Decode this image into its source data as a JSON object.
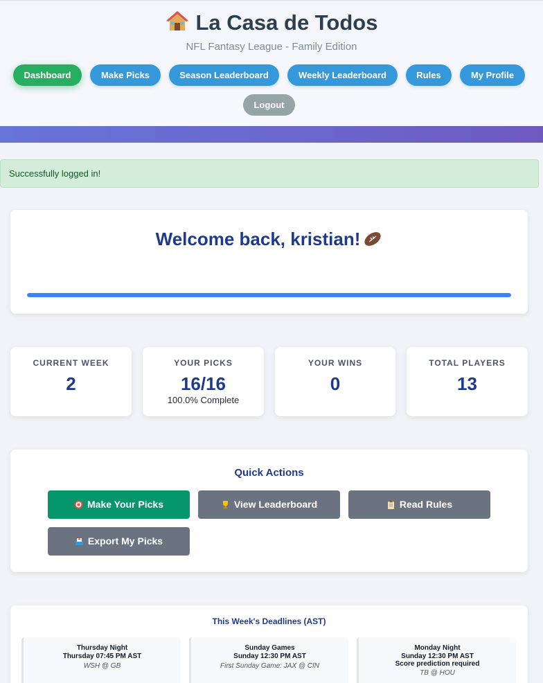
{
  "header": {
    "title": "La Casa de Todos",
    "subtitle": "NFL Fantasy League - Family Edition",
    "nav": [
      "Dashboard",
      "Make Picks",
      "Season Leaderboard",
      "Weekly Leaderboard",
      "Rules",
      "My Profile"
    ],
    "logout": "Logout",
    "active": "Dashboard"
  },
  "alert": {
    "message": "Successfully logged in!"
  },
  "welcome": {
    "title": "Welcome back, kristian!",
    "progress_fraction": 1.0
  },
  "stats": [
    {
      "label": "CURRENT WEEK",
      "value": "2",
      "sub": ""
    },
    {
      "label": "YOUR PICKS",
      "value": "16/16",
      "sub": "100.0% Complete"
    },
    {
      "label": "YOUR WINS",
      "value": "0",
      "sub": ""
    },
    {
      "label": "TOTAL PLAYERS",
      "value": "13",
      "sub": ""
    }
  ],
  "quick_actions": {
    "title": "Quick Actions",
    "buttons": [
      {
        "label": "Make Your Picks",
        "icon": "target-icon"
      },
      {
        "label": "View Leaderboard",
        "icon": "trophy-icon"
      },
      {
        "label": "Read Rules",
        "icon": "clipboard-icon"
      },
      {
        "label": "Export My Picks",
        "icon": "outbox-icon"
      }
    ]
  },
  "deadlines": {
    "title": "This Week's Deadlines (AST)",
    "items": [
      {
        "heading": "Thursday Night",
        "time": "Thursday 07:45 PM AST",
        "extra": "",
        "game": "WSH @ GB"
      },
      {
        "heading": "Sunday Games",
        "time": "Sunday 12:30 PM AST",
        "extra": "",
        "game": "First Sunday Game: JAX @ CIN"
      },
      {
        "heading": "Monday Night",
        "time": "Sunday 12:30 PM AST",
        "extra": "Score prediction required",
        "game": "TB @ HOU"
      }
    ]
  },
  "colors": {
    "nav_blue": "#3498db",
    "nav_active_green": "#27ae60",
    "logout_gray": "#95a5a6",
    "accent_navy": "#1e3a8a",
    "primary_action_green": "#059669"
  }
}
